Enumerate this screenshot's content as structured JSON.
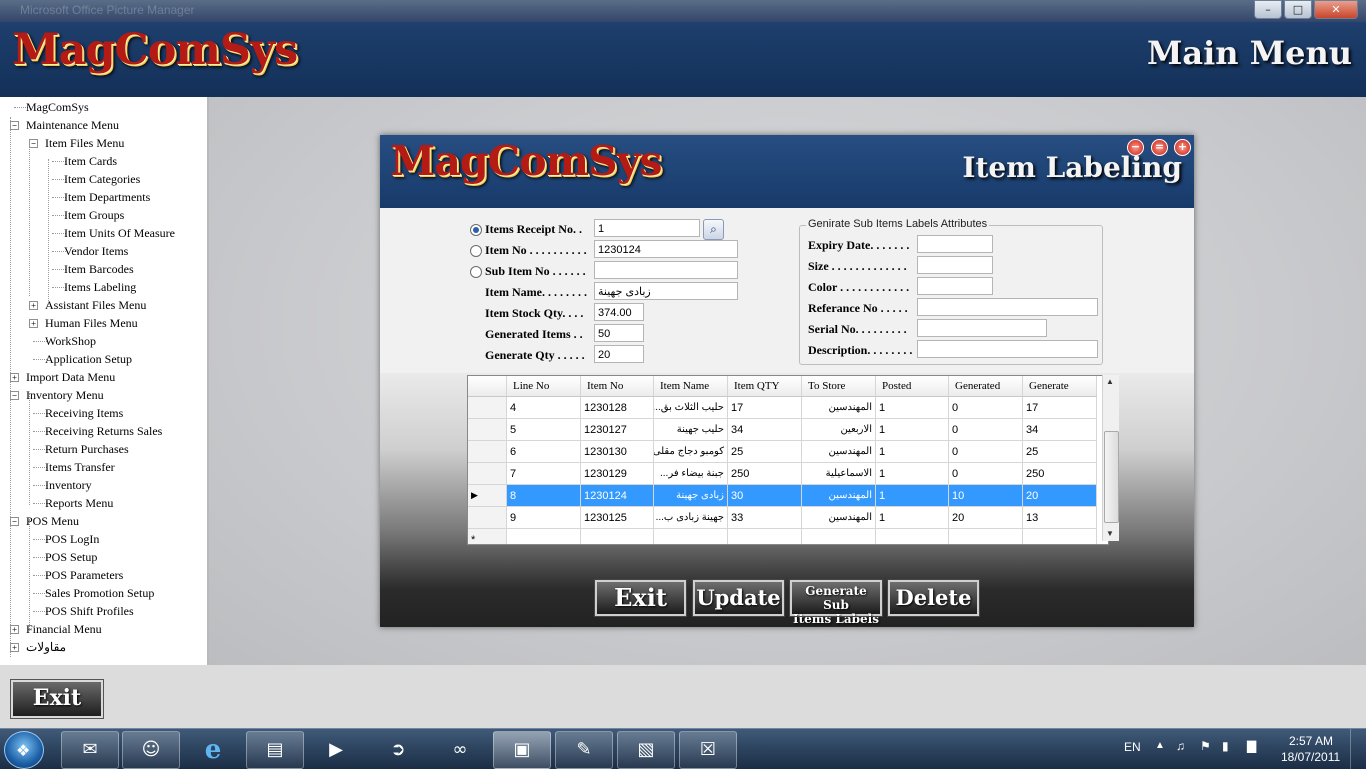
{
  "window": {
    "caption": "Microsoft Office Picture Manager",
    "controls": [
      "minimize-icon",
      "maximize-icon",
      "close-icon"
    ]
  },
  "header": {
    "logo": "MagComSys",
    "title": "Main Menu"
  },
  "tree": [
    {
      "label": "MagComSys",
      "level": 0,
      "box": ""
    },
    {
      "label": "Maintenance Menu",
      "level": 0,
      "box": "−"
    },
    {
      "label": "Item Files Menu",
      "level": 1,
      "box": "−"
    },
    {
      "label": "Item Cards",
      "level": 2,
      "box": ""
    },
    {
      "label": "Item Categories",
      "level": 2,
      "box": ""
    },
    {
      "label": "Item Departments",
      "level": 2,
      "box": ""
    },
    {
      "label": "Item Groups",
      "level": 2,
      "box": ""
    },
    {
      "label": "Item Units Of Measure",
      "level": 2,
      "box": ""
    },
    {
      "label": "Vendor Items",
      "level": 2,
      "box": ""
    },
    {
      "label": "Item Barcodes",
      "level": 2,
      "box": ""
    },
    {
      "label": "Items Labeling",
      "level": 2,
      "box": ""
    },
    {
      "label": "Assistant Files Menu",
      "level": 1,
      "box": "+"
    },
    {
      "label": "Human Files Menu",
      "level": 1,
      "box": "+"
    },
    {
      "label": "WorkShop",
      "level": 1,
      "box": ""
    },
    {
      "label": "Application Setup",
      "level": 1,
      "box": ""
    },
    {
      "label": "Import Data Menu",
      "level": 0,
      "box": "+"
    },
    {
      "label": "Inventory Menu",
      "level": 0,
      "box": "−"
    },
    {
      "label": "Receiving Items",
      "level": 1,
      "box": ""
    },
    {
      "label": "Receiving Returns Sales",
      "level": 1,
      "box": ""
    },
    {
      "label": "Return Purchases",
      "level": 1,
      "box": ""
    },
    {
      "label": "Items Transfer",
      "level": 1,
      "box": ""
    },
    {
      "label": "Inventory",
      "level": 1,
      "box": ""
    },
    {
      "label": "Reports Menu",
      "level": 1,
      "box": ""
    },
    {
      "label": "POS Menu",
      "level": 0,
      "box": "−"
    },
    {
      "label": "POS LogIn",
      "level": 1,
      "box": ""
    },
    {
      "label": "POS Setup",
      "level": 1,
      "box": ""
    },
    {
      "label": "POS Parameters",
      "level": 1,
      "box": ""
    },
    {
      "label": "Sales Promotion Setup",
      "level": 1,
      "box": ""
    },
    {
      "label": "POS Shift Profiles",
      "level": 1,
      "box": ""
    },
    {
      "label": "Financial Menu",
      "level": 0,
      "box": "+"
    },
    {
      "label": "مقاولات",
      "level": 0,
      "box": "+"
    }
  ],
  "exit_main": "Exit",
  "dialog": {
    "logo": "MagComSys",
    "title": "Item Labeling",
    "controls": [
      "minimize-icon",
      "restore-icon",
      "add-icon"
    ],
    "form": {
      "receipt_label": "Items Receipt No. .",
      "receipt_value": "1",
      "item_no_label": "Item No . . . . . . . . . .",
      "item_no_value": "1230124",
      "sub_item_label": "Sub Item No . . . . . .",
      "sub_item_value": "",
      "item_name_label": "Item Name. . . . . . . .",
      "item_name_value": "زبادى جهينة",
      "stock_label": "Item Stock Qty. . . .",
      "stock_value": "374.00",
      "generated_label": "Generated Items . .",
      "generated_value": "50",
      "genqty_label": "Generate Qty . . . . .",
      "genqty_value": "20",
      "selected_radio": "receipt"
    },
    "attributes": {
      "title": "Genirate Sub Items Labels Attributes",
      "expiry": "Expiry Date. . . . . . .",
      "size": "Size . . . . . . . . . . . . .",
      "color": "Color . . . . . . . . . . . .",
      "reference": "Referance No . . . . .",
      "serial": "Serial No. . . . . . . . .",
      "description": "Description. . . . . . . ."
    },
    "grid": {
      "columns": [
        "Line No",
        "Item No",
        "Item Name",
        "Item QTY",
        "To Store",
        "Posted",
        "Generated",
        "Generate"
      ],
      "rows": [
        {
          "line": "4",
          "item_no": "1230128",
          "name": "حليب الثلاث بق...",
          "qty": "17",
          "store": "المهندسين",
          "posted": "1",
          "generated": "0",
          "generate": "17"
        },
        {
          "line": "5",
          "item_no": "1230127",
          "name": "حليب جهينة",
          "qty": "34",
          "store": "الاربعين",
          "posted": "1",
          "generated": "0",
          "generate": "34"
        },
        {
          "line": "6",
          "item_no": "1230130",
          "name": "كومبو دجاج مقلى",
          "qty": "25",
          "store": "المهندسين",
          "posted": "1",
          "generated": "0",
          "generate": "25"
        },
        {
          "line": "7",
          "item_no": "1230129",
          "name": "جبنة بيضاء فر...",
          "qty": "250",
          "store": "الاسماعيلية",
          "posted": "1",
          "generated": "0",
          "generate": "250"
        },
        {
          "line": "8",
          "item_no": "1230124",
          "name": "زبادى جهينة",
          "qty": "30",
          "store": "المهندسين",
          "posted": "1",
          "generated": "10",
          "generate": "20",
          "selected": true
        },
        {
          "line": "9",
          "item_no": "1230125",
          "name": "جهينة زبادى ب...",
          "qty": "33",
          "store": "المهندسين",
          "posted": "1",
          "generated": "20",
          "generate": "13"
        }
      ],
      "new_row_marker": "*"
    },
    "buttons": {
      "exit": "Exit",
      "update": "Update",
      "gen_line1": "Generate Sub",
      "gen_line2": "Items Labels",
      "delete": "Delete"
    }
  },
  "taskbar": {
    "apps": [
      "mail-icon",
      "users-icon",
      "ie-icon",
      "folder-icon",
      "media-icon",
      "arrow-app-icon",
      "teamviewer-icon",
      "picture-manager-icon",
      "pen-icon",
      "notes-icon",
      "app-icon"
    ],
    "language": "EN",
    "time": "2:57 AM",
    "date": "18/07/2011"
  }
}
